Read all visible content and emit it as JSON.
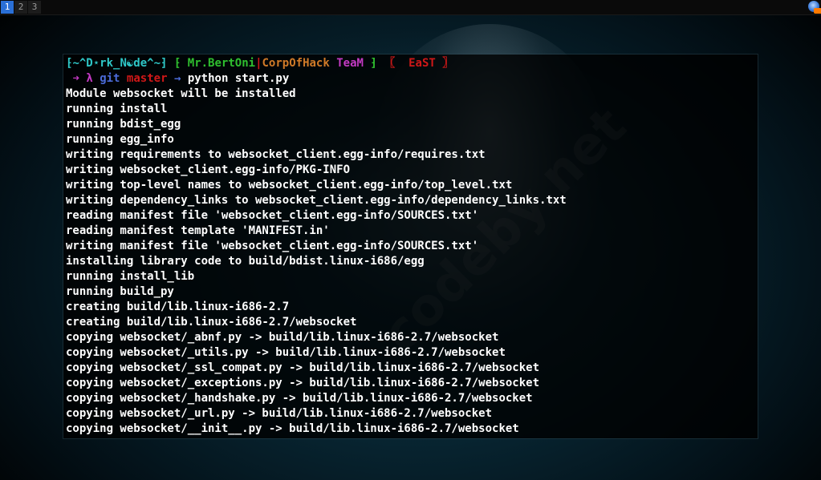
{
  "topbar": {
    "workspaces": [
      "1",
      "2",
      "3"
    ],
    "active_workspace": "1",
    "tray_icon": "notification-icon"
  },
  "wallpaper": {
    "watermark_text": "codeby.net"
  },
  "terminal": {
    "prompt": {
      "user_bracket_open": "⁅",
      "user": "~^D⋆rk_N☯de^~",
      "user_bracket_close": "⁆",
      "team_open": "⁅",
      "team_name1": "Mr.BertOni",
      "team_sep": "|",
      "team_name2": "CorpOfHack",
      "team_name3": "TeaM",
      "team_close": "⁆",
      "east_open": "〖",
      "east": "EaST",
      "east_close": "〗",
      "arrow": "➜",
      "lambda": "λ",
      "git": "git",
      "branch": "master",
      "arrow2": "→",
      "command": "python start.py"
    },
    "output": [
      "Module websocket will be installed",
      "running install",
      "running bdist_egg",
      "running egg_info",
      "writing requirements to websocket_client.egg-info/requires.txt",
      "writing websocket_client.egg-info/PKG-INFO",
      "writing top-level names to websocket_client.egg-info/top_level.txt",
      "writing dependency_links to websocket_client.egg-info/dependency_links.txt",
      "reading manifest file 'websocket_client.egg-info/SOURCES.txt'",
      "reading manifest template 'MANIFEST.in'",
      "writing manifest file 'websocket_client.egg-info/SOURCES.txt'",
      "installing library code to build/bdist.linux-i686/egg",
      "running install_lib",
      "running build_py",
      "creating build/lib.linux-i686-2.7",
      "creating build/lib.linux-i686-2.7/websocket",
      "copying websocket/_abnf.py -> build/lib.linux-i686-2.7/websocket",
      "copying websocket/_utils.py -> build/lib.linux-i686-2.7/websocket",
      "copying websocket/_ssl_compat.py -> build/lib.linux-i686-2.7/websocket",
      "copying websocket/_exceptions.py -> build/lib.linux-i686-2.7/websocket",
      "copying websocket/_handshake.py -> build/lib.linux-i686-2.7/websocket",
      "copying websocket/_url.py -> build/lib.linux-i686-2.7/websocket",
      "copying websocket/__init__.py -> build/lib.linux-i686-2.7/websocket"
    ]
  },
  "colors": {
    "active_workspace": "#2a6fd6",
    "prompt_user": "#2ec7c7",
    "prompt_team": "#2fbf2f",
    "prompt_team2": "#d07a28",
    "prompt_team3": "#c43ac4",
    "prompt_east": "#d01818",
    "prompt_git": "#4b6bd8",
    "terminal_text": "#ffffff"
  }
}
